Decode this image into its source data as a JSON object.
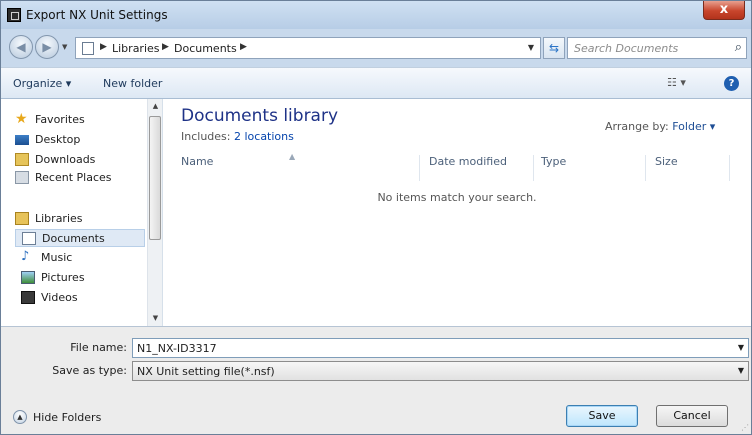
{
  "window": {
    "title": "Export NX Unit Settings",
    "close": "x"
  },
  "nav": {
    "crumbs": [
      "Libraries",
      "Documents"
    ],
    "search_placeholder": "Search Documents"
  },
  "toolbar": {
    "organize": "Organize ▾",
    "new_folder": "New folder",
    "views": "☷ ▾",
    "help": "?"
  },
  "navpane": {
    "favorites": "Favorites",
    "desktop": "Desktop",
    "downloads": "Downloads",
    "recent": "Recent Places",
    "libraries": "Libraries",
    "documents": "Documents",
    "music": "Music",
    "pictures": "Pictures",
    "videos": "Videos"
  },
  "content": {
    "title": "Documents library",
    "includes_label": "Includes:",
    "includes_link": "2 locations",
    "arrange_label": "Arrange by:",
    "arrange_value": "Folder ▾",
    "columns": [
      "Name",
      "Date modified",
      "Type",
      "Size"
    ],
    "empty_message": "No items match your search."
  },
  "form": {
    "file_name_label": "File name:",
    "file_name_value": "N1_NX-ID3317",
    "save_type_label": "Save as type:",
    "save_type_value": "NX Unit setting file(*.nsf)"
  },
  "footer": {
    "hide_folders": "Hide Folders",
    "save": "Save",
    "cancel": "Cancel"
  }
}
